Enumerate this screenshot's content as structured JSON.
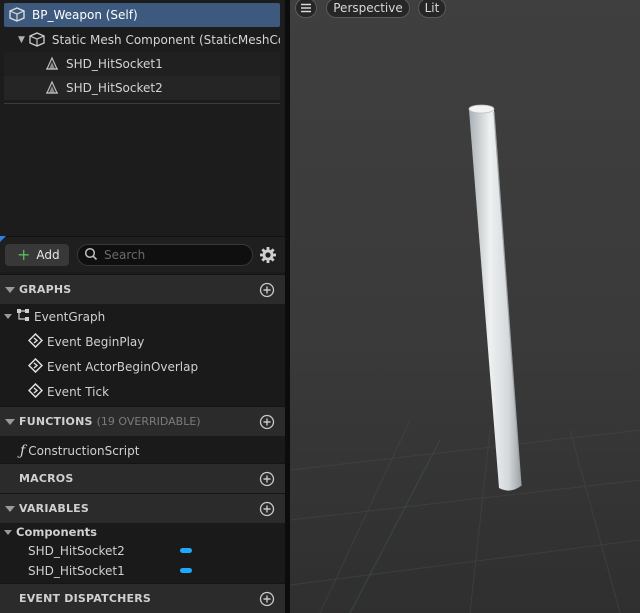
{
  "components": {
    "self": "BP_Weapon (Self)",
    "mesh": "Static Mesh Component (StaticMeshComponent)",
    "sockets": [
      "SHD_HitSocket1",
      "SHD_HitSocket2"
    ]
  },
  "toolbar": {
    "add_label": "Add",
    "search_placeholder": "Search"
  },
  "sections": {
    "graphs": "GRAPHS",
    "functions": "FUNCTIONS",
    "functions_sub": "(19 OVERRIDABLE)",
    "macros": "MACROS",
    "variables": "VARIABLES",
    "event_dispatchers": "EVENT DISPATCHERS"
  },
  "graphs": {
    "event_graph": "EventGraph",
    "events": [
      "Event BeginPlay",
      "Event ActorBeginOverlap",
      "Event Tick"
    ]
  },
  "functions": [
    "ConstructionScript"
  ],
  "variables": {
    "category": "Components",
    "items": [
      "SHD_HitSocket2",
      "SHD_HitSocket1"
    ]
  },
  "viewport": {
    "view_mode": "Perspective",
    "lighting": "Lit"
  },
  "colors": {
    "selection": "#3d5a7e",
    "variable_pill": "#1fa8ff",
    "add_plus": "#5cb85c"
  }
}
